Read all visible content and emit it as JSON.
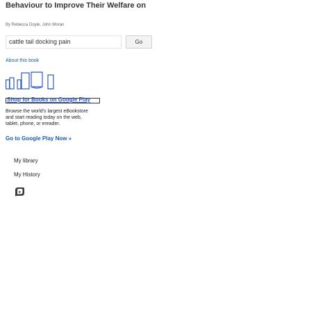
{
  "book": {
    "title": "Behaviour to Improve Their Welfare on",
    "authors": "By Rebecca Doyle, John Moran"
  },
  "search": {
    "value": "cattle tail docking pain",
    "go_label": "Go"
  },
  "about_label": "About this book",
  "shop": {
    "label": "Shop for Books on Google Play"
  },
  "browse_text": "Browse the world's largest eBookstore and start reading today on the web, tablet, phone, or ereader.",
  "play_link_label": "Go to Google Play Now »",
  "menu": {
    "library": "My library",
    "history": "My History"
  },
  "icons": {
    "play": "google-play-books-icon"
  },
  "colors": {
    "link": "#1a5ca8",
    "shop_link": "#2a56c6"
  }
}
